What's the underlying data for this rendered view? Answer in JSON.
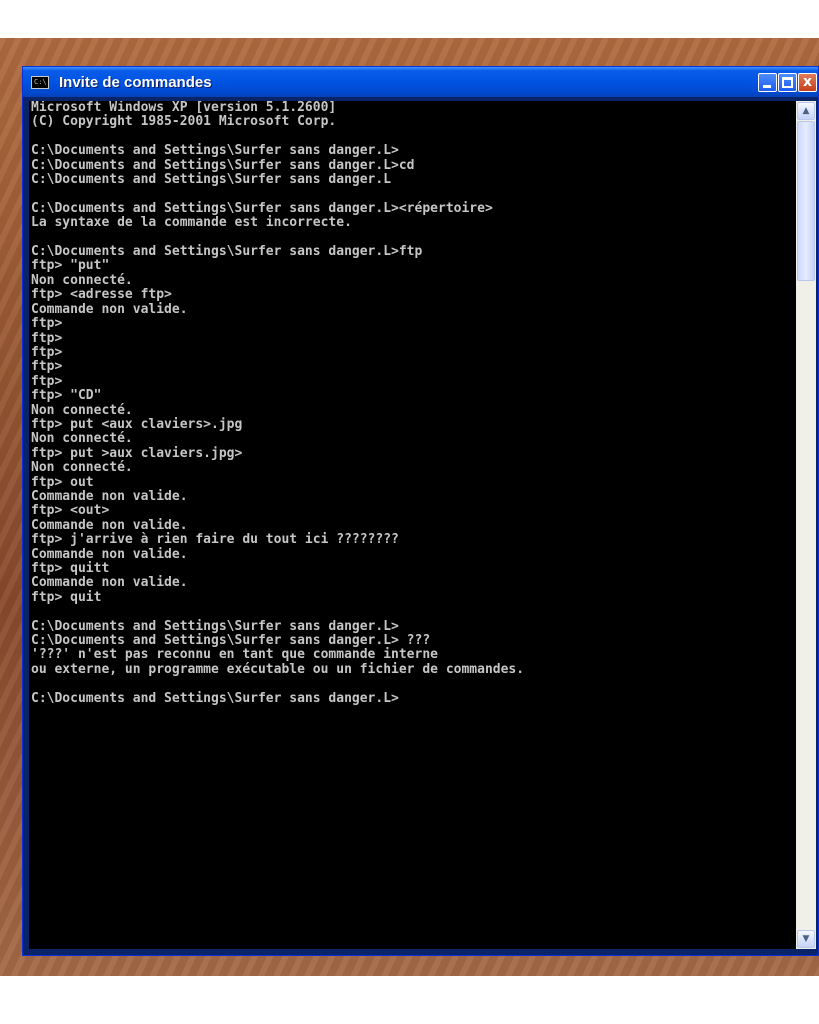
{
  "window": {
    "title": "Invite de commandes",
    "icon": "console-icon",
    "title_icon_text": "C:\\"
  },
  "title_buttons": {
    "minimize": "minimize-icon",
    "maximize": "maximize-icon",
    "close_label": "x"
  },
  "scrollbar": {
    "up_arrow": "▲",
    "down_arrow": "▼"
  },
  "colors": {
    "console_background": "#000000",
    "console_text": "#c6c6c6",
    "titlebar": "#0054e3"
  },
  "console": {
    "lines": [
      "Microsoft Windows XP [version 5.1.2600]",
      "(C) Copyright 1985-2001 Microsoft Corp.",
      "",
      "C:\\Documents and Settings\\Surfer sans danger.L>",
      "C:\\Documents and Settings\\Surfer sans danger.L>cd",
      "C:\\Documents and Settings\\Surfer sans danger.L",
      "",
      "C:\\Documents and Settings\\Surfer sans danger.L><répertoire>",
      "La syntaxe de la commande est incorrecte.",
      "",
      "C:\\Documents and Settings\\Surfer sans danger.L>ftp",
      "ftp> \"put\"",
      "Non connecté.",
      "ftp> <adresse ftp>",
      "Commande non valide.",
      "ftp>",
      "ftp>",
      "ftp>",
      "ftp>",
      "ftp>",
      "ftp> \"CD\"",
      "Non connecté.",
      "ftp> put <aux claviers>.jpg",
      "Non connecté.",
      "ftp> put >aux claviers.jpg>",
      "Non connecté.",
      "ftp> out",
      "Commande non valide.",
      "ftp> <out>",
      "Commande non valide.",
      "ftp> j'arrive à rien faire du tout ici ????????",
      "Commande non valide.",
      "ftp> quitt",
      "Commande non valide.",
      "ftp> quit",
      "",
      "C:\\Documents and Settings\\Surfer sans danger.L>",
      "C:\\Documents and Settings\\Surfer sans danger.L> ???",
      "'???' n'est pas reconnu en tant que commande interne",
      "ou externe, un programme exécutable ou un fichier de commandes.",
      "",
      "C:\\Documents and Settings\\Surfer sans danger.L>"
    ]
  }
}
